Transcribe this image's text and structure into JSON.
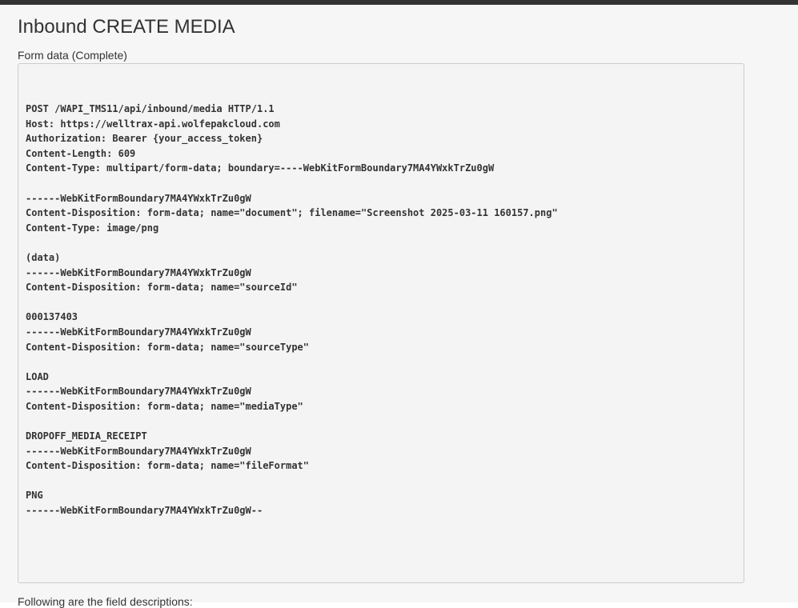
{
  "page": {
    "title": "Inbound CREATE MEDIA",
    "form_label": "Form data (Complete)",
    "footer_text": "Following are the field descriptions:"
  },
  "code_block": {
    "lines": [
      "POST /WAPI_TMS11/api/inbound/media HTTP/1.1",
      "Host: https://welltrax-api.wolfepakcloud.com",
      "Authorization: Bearer {your_access_token}",
      "Content-Length: 609",
      "Content-Type: multipart/form-data; boundary=----WebKitFormBoundary7MA4YWxkTrZu0gW",
      "",
      "------WebKitFormBoundary7MA4YWxkTrZu0gW",
      "Content-Disposition: form-data; name=\"document\"; filename=\"Screenshot 2025-03-11 160157.png\"",
      "Content-Type: image/png",
      "",
      "(data)",
      "------WebKitFormBoundary7MA4YWxkTrZu0gW",
      "Content-Disposition: form-data; name=\"sourceId\"",
      "",
      "000137403",
      "------WebKitFormBoundary7MA4YWxkTrZu0gW",
      "Content-Disposition: form-data; name=\"sourceType\"",
      "",
      "LOAD",
      "------WebKitFormBoundary7MA4YWxkTrZu0gW",
      "Content-Disposition: form-data; name=\"mediaType\"",
      "",
      "DROPOFF_MEDIA_RECEIPT",
      "------WebKitFormBoundary7MA4YWxkTrZu0gW",
      "Content-Disposition: form-data; name=\"fileFormat\"",
      "",
      "PNG",
      "------WebKitFormBoundary7MA4YWxkTrZu0gW--"
    ]
  }
}
